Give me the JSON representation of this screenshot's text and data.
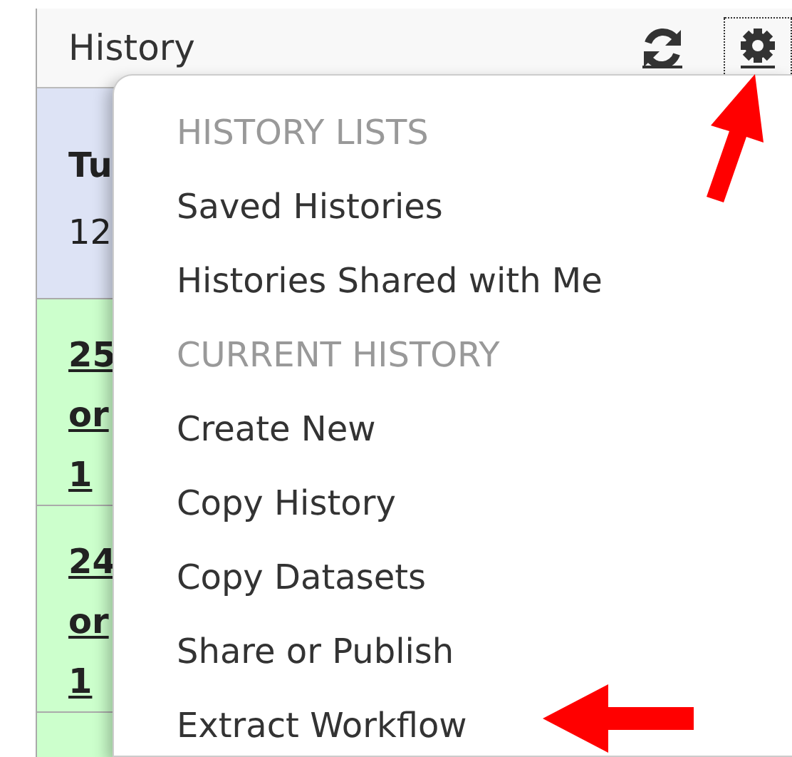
{
  "panel": {
    "title": "History",
    "buttons": [
      {
        "kind": "refresh",
        "focused": false
      },
      {
        "kind": "settings",
        "focused": true
      }
    ],
    "rows": [
      {
        "kind": "current",
        "lines": [
          "Tu",
          "12"
        ]
      },
      {
        "kind": "dataset",
        "lines": [
          "25",
          "or",
          "1"
        ]
      },
      {
        "kind": "dataset",
        "lines": [
          "24",
          "or",
          "1"
        ]
      },
      {
        "kind": "dataset"
      }
    ]
  },
  "menu": [
    {
      "kind": "header",
      "label": "HISTORY LISTS"
    },
    {
      "kind": "item",
      "label": "Saved Histories"
    },
    {
      "kind": "item",
      "label": "Histories Shared with Me"
    },
    {
      "kind": "header",
      "label": "CURRENT HISTORY"
    },
    {
      "kind": "item",
      "label": "Create New"
    },
    {
      "kind": "item",
      "label": "Copy History"
    },
    {
      "kind": "item",
      "label": "Copy Datasets"
    },
    {
      "kind": "item",
      "label": "Share or Publish"
    },
    {
      "kind": "item",
      "label": "Extract Workflow"
    }
  ],
  "annotations": [
    {
      "kind": "arrow-up"
    },
    {
      "kind": "arrow-left"
    }
  ]
}
